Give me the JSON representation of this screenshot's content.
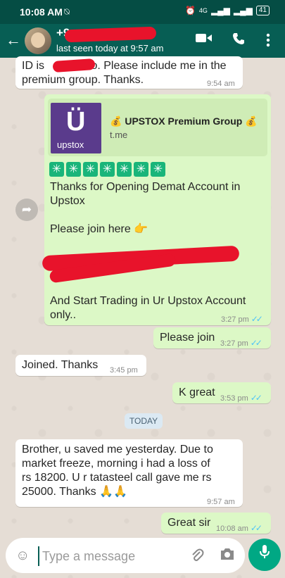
{
  "status_bar": {
    "time": "10:08 AM",
    "battery": "41",
    "signal": "4G"
  },
  "header": {
    "contact": "+9",
    "last_seen": "last seen today at 9:57 am"
  },
  "messages": [
    {
      "id": "m1",
      "dir": "in",
      "lines": [
        "ID is",
        "o. Please include me in the",
        "premium group. Thanks."
      ],
      "time": "9:54 am"
    },
    {
      "id": "m2",
      "dir": "out",
      "link_title": "UPSTOX Premium Group",
      "link_domain": "t.me",
      "logo_brand": "upstox",
      "line1": "Thanks for Opening Demat Account in",
      "line2": "Upstox",
      "line3": "Please join here",
      "line4": "And Start Trading in Ur Upstox Account",
      "line5": "only..",
      "time": "3:27 pm"
    },
    {
      "id": "m3",
      "dir": "out",
      "text": "Please join",
      "time": "3:27 pm"
    },
    {
      "id": "m4",
      "dir": "in",
      "text": "Joined. Thanks",
      "time": "3:45 pm"
    },
    {
      "id": "m5",
      "dir": "out",
      "text": "K great",
      "time": "3:53 pm"
    },
    {
      "id": "m6",
      "dir": "in",
      "lines": [
        "Brother, u saved me yesterday. Due to",
        "market freeze, morning i had a loss of",
        "rs 18200. U r tatasteel call gave me rs",
        "25000. Thanks"
      ],
      "time": "9:57 am"
    },
    {
      "id": "m7",
      "dir": "out",
      "text": "Great sir",
      "time": "10:08 am"
    }
  ],
  "date_divider": "TODAY",
  "input": {
    "placeholder": "Type a message"
  },
  "icons": {
    "back": "back-arrow-icon",
    "video": "video-call-icon",
    "call": "phone-icon",
    "menu": "more-vert-icon",
    "emoji": "emoji-icon",
    "attach": "attach-icon",
    "camera": "camera-icon",
    "mic": "mic-icon",
    "forward": "forward-icon"
  },
  "colors": {
    "header": "#075e54",
    "outgoing": "#dcf8c6",
    "incoming": "#ffffff",
    "accent": "#00a884",
    "ticks": "#4fc3f7"
  }
}
